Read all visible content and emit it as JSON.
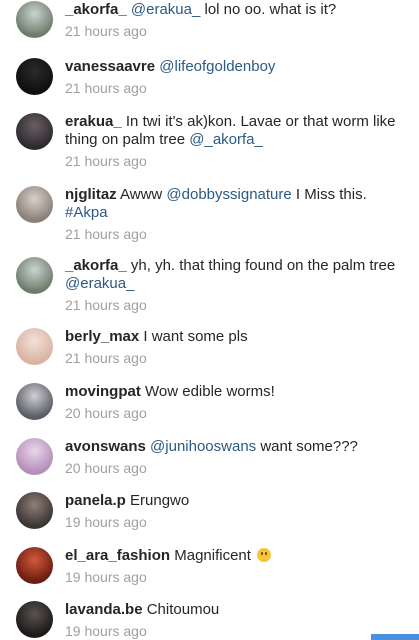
{
  "comments": [
    {
      "username": "_akorfa_",
      "segments": [
        {
          "t": "@erakua_",
          "m": true
        },
        {
          "t": " lol no oo. what is it?",
          "m": false
        }
      ],
      "time": "21 hours ago",
      "avatar": [
        "#6f7c6b",
        "#c9d4d2"
      ]
    },
    {
      "username": "vanessaavre",
      "segments": [
        {
          "t": "@lifeofgoldenboy",
          "m": true
        }
      ],
      "time": "21 hours ago",
      "avatar": [
        "#0f0f0f",
        "#2a2a2a"
      ]
    },
    {
      "username": "erakua_",
      "segments": [
        {
          "t": "In twi it's ak)kon. Lavae or that worm like thing on palm tree ",
          "m": false
        },
        {
          "t": "@_akorfa_",
          "m": true
        }
      ],
      "time": "21 hours ago",
      "avatar": [
        "#2d2a2f",
        "#6a5f63"
      ]
    },
    {
      "username": "njglitaz",
      "segments": [
        {
          "t": "Awww ",
          "m": false
        },
        {
          "t": "@dobbyssignature",
          "m": true
        },
        {
          "t": " I Miss this. ",
          "m": false
        },
        {
          "t": "#Akpa",
          "m": true
        }
      ],
      "time": "21 hours ago",
      "avatar": [
        "#8c7f79",
        "#d9cfc9"
      ]
    },
    {
      "username": "_akorfa_",
      "segments": [
        {
          "t": "yh, yh. that thing found on the palm tree ",
          "m": false
        },
        {
          "t": "@erakua_",
          "m": true
        }
      ],
      "time": "21 hours ago",
      "avatar": [
        "#6f7c6b",
        "#c9d4d2"
      ]
    },
    {
      "username": "berly_max",
      "segments": [
        {
          "t": "I want some pls",
          "m": false
        }
      ],
      "time": "21 hours ago",
      "avatar": [
        "#d9b3a3",
        "#f3e1d8"
      ]
    },
    {
      "username": "movingpat",
      "segments": [
        {
          "t": "Wow edible worms!",
          "m": false
        }
      ],
      "time": "20 hours ago",
      "avatar": [
        "#5b5e66",
        "#cfcfd3"
      ]
    },
    {
      "username": "avonswans",
      "segments": [
        {
          "t": "@junihooswans",
          "m": true
        },
        {
          "t": " want some???",
          "m": false
        }
      ],
      "time": "20 hours ago",
      "avatar": [
        "#b48fb8",
        "#e9d6ea"
      ]
    },
    {
      "username": "panela.p",
      "segments": [
        {
          "t": "Erungwo",
          "m": false
        }
      ],
      "time": "19 hours ago",
      "avatar": [
        "#3b3532",
        "#8e7f77"
      ]
    },
    {
      "username": "el_ara_fashion",
      "segments": [
        {
          "t": "Magnificent ",
          "m": false
        }
      ],
      "emoji": "grinning-face-emoji",
      "time": "19 hours ago",
      "avatar": [
        "#6b1d12",
        "#d4583c"
      ]
    },
    {
      "username": "lavanda.be",
      "segments": [
        {
          "t": "Chitoumou",
          "m": false
        }
      ],
      "time": "19 hours ago",
      "avatar": [
        "#1c1a19",
        "#5a5350"
      ]
    }
  ]
}
